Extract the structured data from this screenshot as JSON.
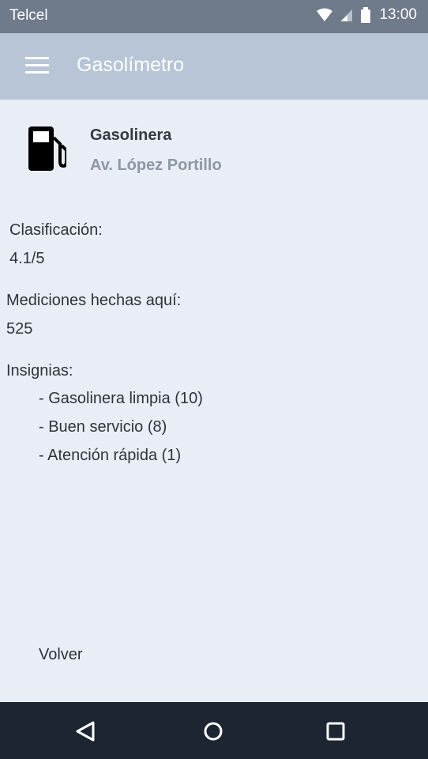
{
  "status_bar": {
    "carrier": "Telcel",
    "time": "13:00",
    "icons": [
      "wifi-icon",
      "signal-icon",
      "battery-icon"
    ]
  },
  "app_bar": {
    "title": "Gasolímetro",
    "menu_icon": "menu-icon"
  },
  "station": {
    "icon": "gas-pump-icon",
    "name": "Gasolinera",
    "address": "Av. López Portillo"
  },
  "details": {
    "rating_label": "Clasificación:",
    "rating_value": "4.1/5",
    "measurements_label": "Mediciones hechas aquí:",
    "measurements_value": "525",
    "badges_label": "Insignias:",
    "badges": [
      "- Gasolinera limpia (10)",
      "- Buen servicio (8)",
      "- Atención rápida (1)"
    ]
  },
  "back_label": "Volver",
  "nav_bar": {
    "icons": [
      "back-triangle-icon",
      "home-circle-icon",
      "recents-square-icon"
    ]
  },
  "colors": {
    "status_bar": "#6f7a8b",
    "app_bar": "#b7c5d6",
    "background": "#e9eef6",
    "nav_bar": "#1d2533",
    "address_text": "#8d97a5"
  }
}
